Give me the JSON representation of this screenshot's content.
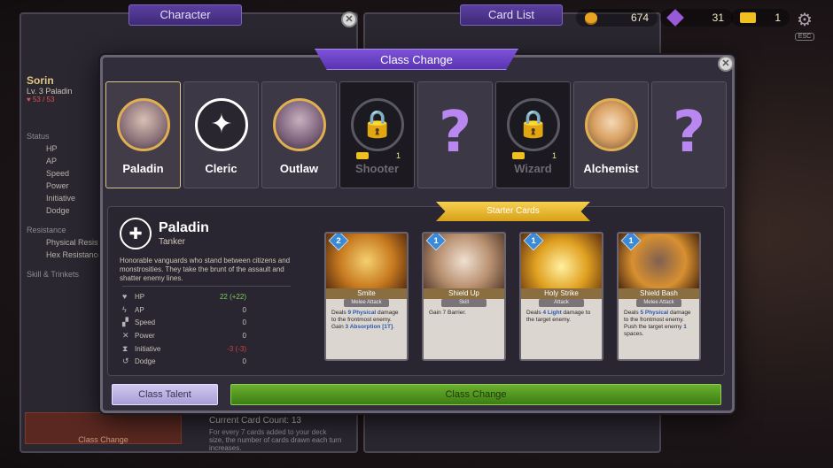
{
  "topbar": {
    "character_tab": "Character",
    "card_list_tab": "Card List",
    "gold": "674",
    "gems": "31",
    "tickets": "1",
    "settings_hint": "ESC"
  },
  "hero": {
    "name": "Sorin",
    "level": "Lv. 3 Paladin",
    "hp": "53 / 53",
    "status_heading": "Status",
    "status_items": [
      "HP",
      "AP",
      "Speed",
      "Power",
      "Initiative",
      "Dodge"
    ],
    "resistance_heading": "Resistance",
    "resistances": [
      "Physical Resistance",
      "Hex Resistance"
    ],
    "skills_heading": "Skill & Trinkets"
  },
  "modal": {
    "title": "Class Change",
    "classes": [
      {
        "name": "Paladin",
        "state": "selected"
      },
      {
        "name": "Cleric",
        "state": "available"
      },
      {
        "name": "Outlaw",
        "state": "available"
      },
      {
        "name": "Shooter",
        "state": "locked",
        "cost": "1"
      },
      {
        "name": "",
        "state": "unknown"
      },
      {
        "name": "Wizard",
        "state": "locked",
        "cost": "1"
      },
      {
        "name": "Alchemist",
        "state": "available"
      },
      {
        "name": "",
        "state": "unknown"
      }
    ],
    "selected": {
      "name": "Paladin",
      "role": "Tanker",
      "description": "Honorable vanguards who stand between citizens and monstrosities. They take the brunt of the assault and shatter enemy lines.",
      "stats": [
        {
          "name": "HP",
          "value": "22 (+22)",
          "color": "#7ed05a"
        },
        {
          "name": "AP",
          "value": "0",
          "color": "#c8c0b8"
        },
        {
          "name": "Speed",
          "value": "0",
          "color": "#c8c0b8"
        },
        {
          "name": "Power",
          "value": "0",
          "color": "#c8c0b8"
        },
        {
          "name": "Initiative",
          "value": "-3 (-3)",
          "color": "#d04040"
        },
        {
          "name": "Dodge",
          "value": "0",
          "color": "#c8c0b8"
        }
      ]
    },
    "starter_label": "Starter Cards",
    "cards": [
      {
        "cost": "2",
        "name": "Smite",
        "type": "Melee Attack",
        "text_a": "Deals ",
        "val_a": "9 Physical",
        "text_b": " damage to the frontmost enemy. Gain ",
        "val_b": "3 Absorption [1T]",
        "text_c": "."
      },
      {
        "cost": "1",
        "name": "Shield Up",
        "type": "Skill",
        "text_a": "Gain ",
        "val_a": "7",
        "text_b": " Barrier.",
        "val_b": "",
        "text_c": ""
      },
      {
        "cost": "1",
        "name": "Holy Strike",
        "type": "Attack",
        "text_a": "Deals ",
        "val_a": "4 Light",
        "text_b": " damage to the target enemy.",
        "val_b": "",
        "text_c": ""
      },
      {
        "cost": "1",
        "name": "Shield Bash",
        "type": "Melee Attack",
        "text_a": "Deals ",
        "val_a": "5 Physical",
        "text_b": " damage to the frontmost enemy. Push the target enemy ",
        "val_b": "1",
        "text_c": " spaces."
      }
    ],
    "talent_button": "Class Talent",
    "change_button": "Class Change"
  },
  "underlay": {
    "card_count": "Current Card Count: 13",
    "card_note": "For every 7 cards added to your deck size, the number of cards drawn each turn increases.",
    "class_change_btn": "Class Change"
  }
}
